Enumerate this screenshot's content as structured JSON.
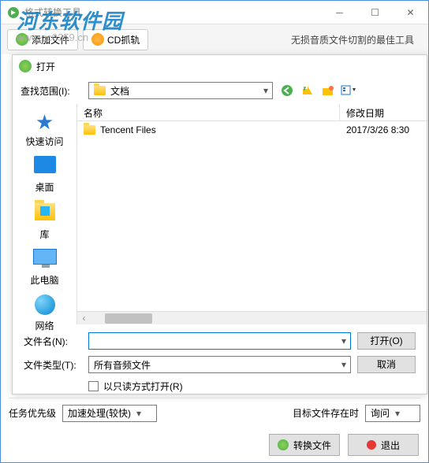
{
  "main": {
    "title": "格式转换工具",
    "toolbar": {
      "add_files": "添加文件",
      "cd_rip": "CD抓轨",
      "desc": "无损音质文件切割的最佳工具"
    }
  },
  "watermark": {
    "name": "河东软件园",
    "url": "www.pc0359.cn"
  },
  "dialog": {
    "title": "打开",
    "lookup_label": "查找范围(I):",
    "lookup_value": "文档",
    "columns": {
      "name": "名称",
      "date": "修改日期"
    },
    "rows": [
      {
        "name": "Tencent Files",
        "date": "2017/3/26 8:30"
      }
    ],
    "places": {
      "quick": "快速访问",
      "desktop": "桌面",
      "library": "库",
      "thispc": "此电脑",
      "network": "网络"
    },
    "filename_label": "文件名(N):",
    "filename_value": "",
    "filetype_label": "文件类型(T):",
    "filetype_value": "所有音频文件",
    "readonly_label": "以只读方式打开(R)",
    "open_btn": "打开(O)",
    "cancel_btn": "取消"
  },
  "bottom": {
    "priority_label": "任务优先级",
    "priority_value": "加速处理(较快)",
    "exists_label": "目标文件存在时",
    "exists_value": "询问"
  },
  "footer": {
    "convert": "转换文件",
    "exit": "退出"
  }
}
